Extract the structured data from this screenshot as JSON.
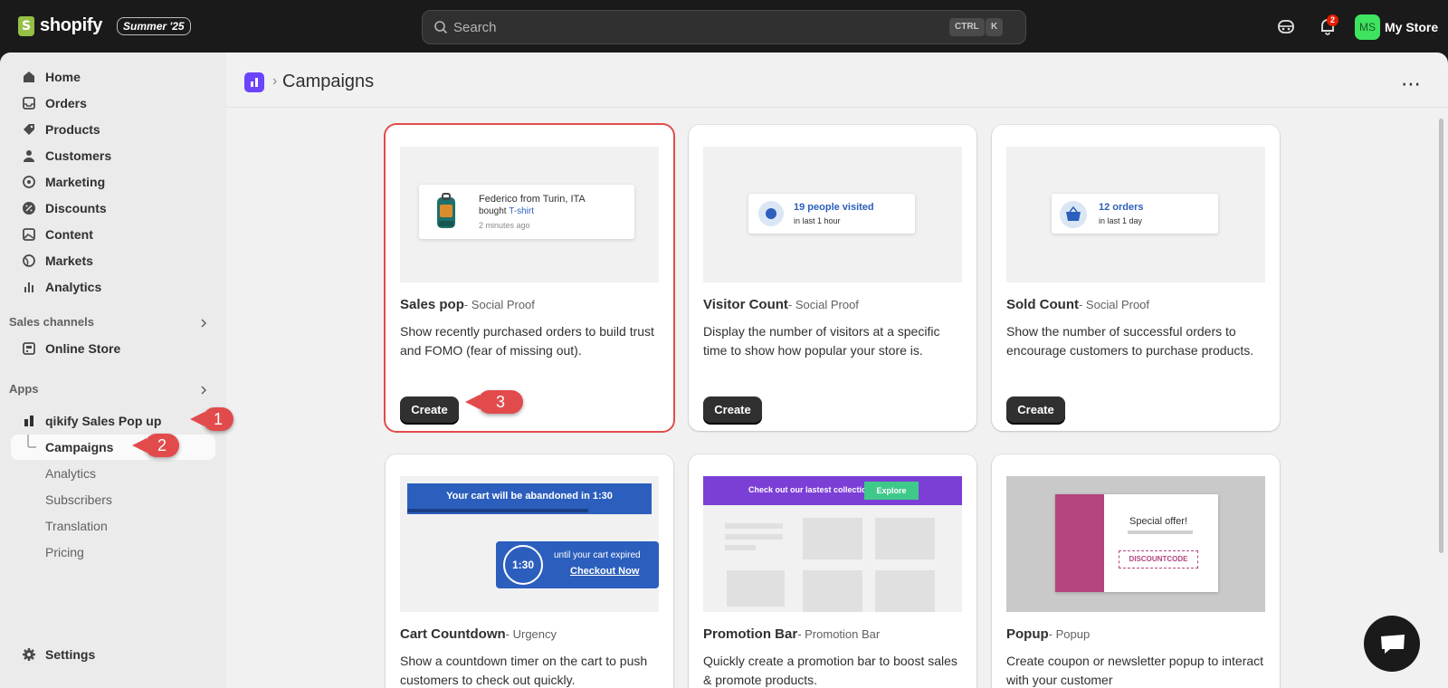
{
  "topbar": {
    "logo_text": "shopify",
    "edition_badge": "Summer '25",
    "search_placeholder": "Search",
    "shortcut_ctrl": "CTRL",
    "shortcut_k": "K",
    "notification_count": "2",
    "avatar_initials": "MS",
    "store_name": "My Store"
  },
  "sidebar": {
    "items": [
      {
        "label": "Home",
        "icon": "home-icon"
      },
      {
        "label": "Orders",
        "icon": "inbox-icon"
      },
      {
        "label": "Products",
        "icon": "tag-icon"
      },
      {
        "label": "Customers",
        "icon": "person-icon"
      },
      {
        "label": "Marketing",
        "icon": "target-icon"
      },
      {
        "label": "Discounts",
        "icon": "discount-icon"
      },
      {
        "label": "Content",
        "icon": "image-icon"
      },
      {
        "label": "Markets",
        "icon": "globe-icon"
      },
      {
        "label": "Analytics",
        "icon": "bar-chart-icon"
      }
    ],
    "sales_channels_label": "Sales channels",
    "online_store_label": "Online Store",
    "apps_label": "Apps",
    "app_name": "qikify Sales Pop up",
    "app_subitems": [
      "Campaigns",
      "Analytics",
      "Subscribers",
      "Translation",
      "Pricing"
    ],
    "settings_label": "Settings"
  },
  "callouts": [
    "1",
    "2",
    "3"
  ],
  "page": {
    "title": "Campaigns",
    "more_label": "⋯"
  },
  "cards": [
    {
      "title": "Sales pop",
      "tag": "- Social Proof",
      "description": "Show recently purchased orders to build trust and FOMO (fear of missing out).",
      "button": "Create",
      "preview": {
        "name": "Federico from Turin, ITA",
        "bought": "bought ",
        "product": "T-shirt",
        "time": "2 minutes ago"
      }
    },
    {
      "title": "Visitor Count",
      "tag": "- Social Proof",
      "description": "Display the number of visitors at a specific time to show how popular your store is.",
      "button": "Create",
      "preview": {
        "headline": "19 people visited",
        "sub": "in last 1 hour"
      }
    },
    {
      "title": "Sold Count",
      "tag": "- Social Proof",
      "description": "Show the number of successful orders to encourage customers to purchase products.",
      "button": "Create",
      "preview": {
        "headline": "12 orders",
        "sub": "in last 1 day"
      }
    },
    {
      "title": "Cart Countdown",
      "tag": "- Urgency",
      "description": "Show a countdown timer on the cart to push customers to check out quickly.",
      "preview": {
        "bar": "Your cart will be abandoned in 1:30",
        "timer": "1:30",
        "expire": "until your cart expired",
        "checkout": "Checkout Now"
      }
    },
    {
      "title": "Promotion Bar",
      "tag": "- Promotion Bar",
      "description": "Quickly create a promotion bar to boost sales & promote products.",
      "preview": {
        "bar": "Check out our lastest collection",
        "button": "Explore"
      }
    },
    {
      "title": "Popup",
      "tag": "- Popup",
      "description": "Create coupon or newsletter popup to interact with your customer",
      "preview": {
        "headline": "Special offer!",
        "code": "DISCOUNTCODE"
      }
    }
  ],
  "colors": {
    "accent": "#e24b4b",
    "brand": "#95bf47",
    "app": "#6a44ff"
  }
}
